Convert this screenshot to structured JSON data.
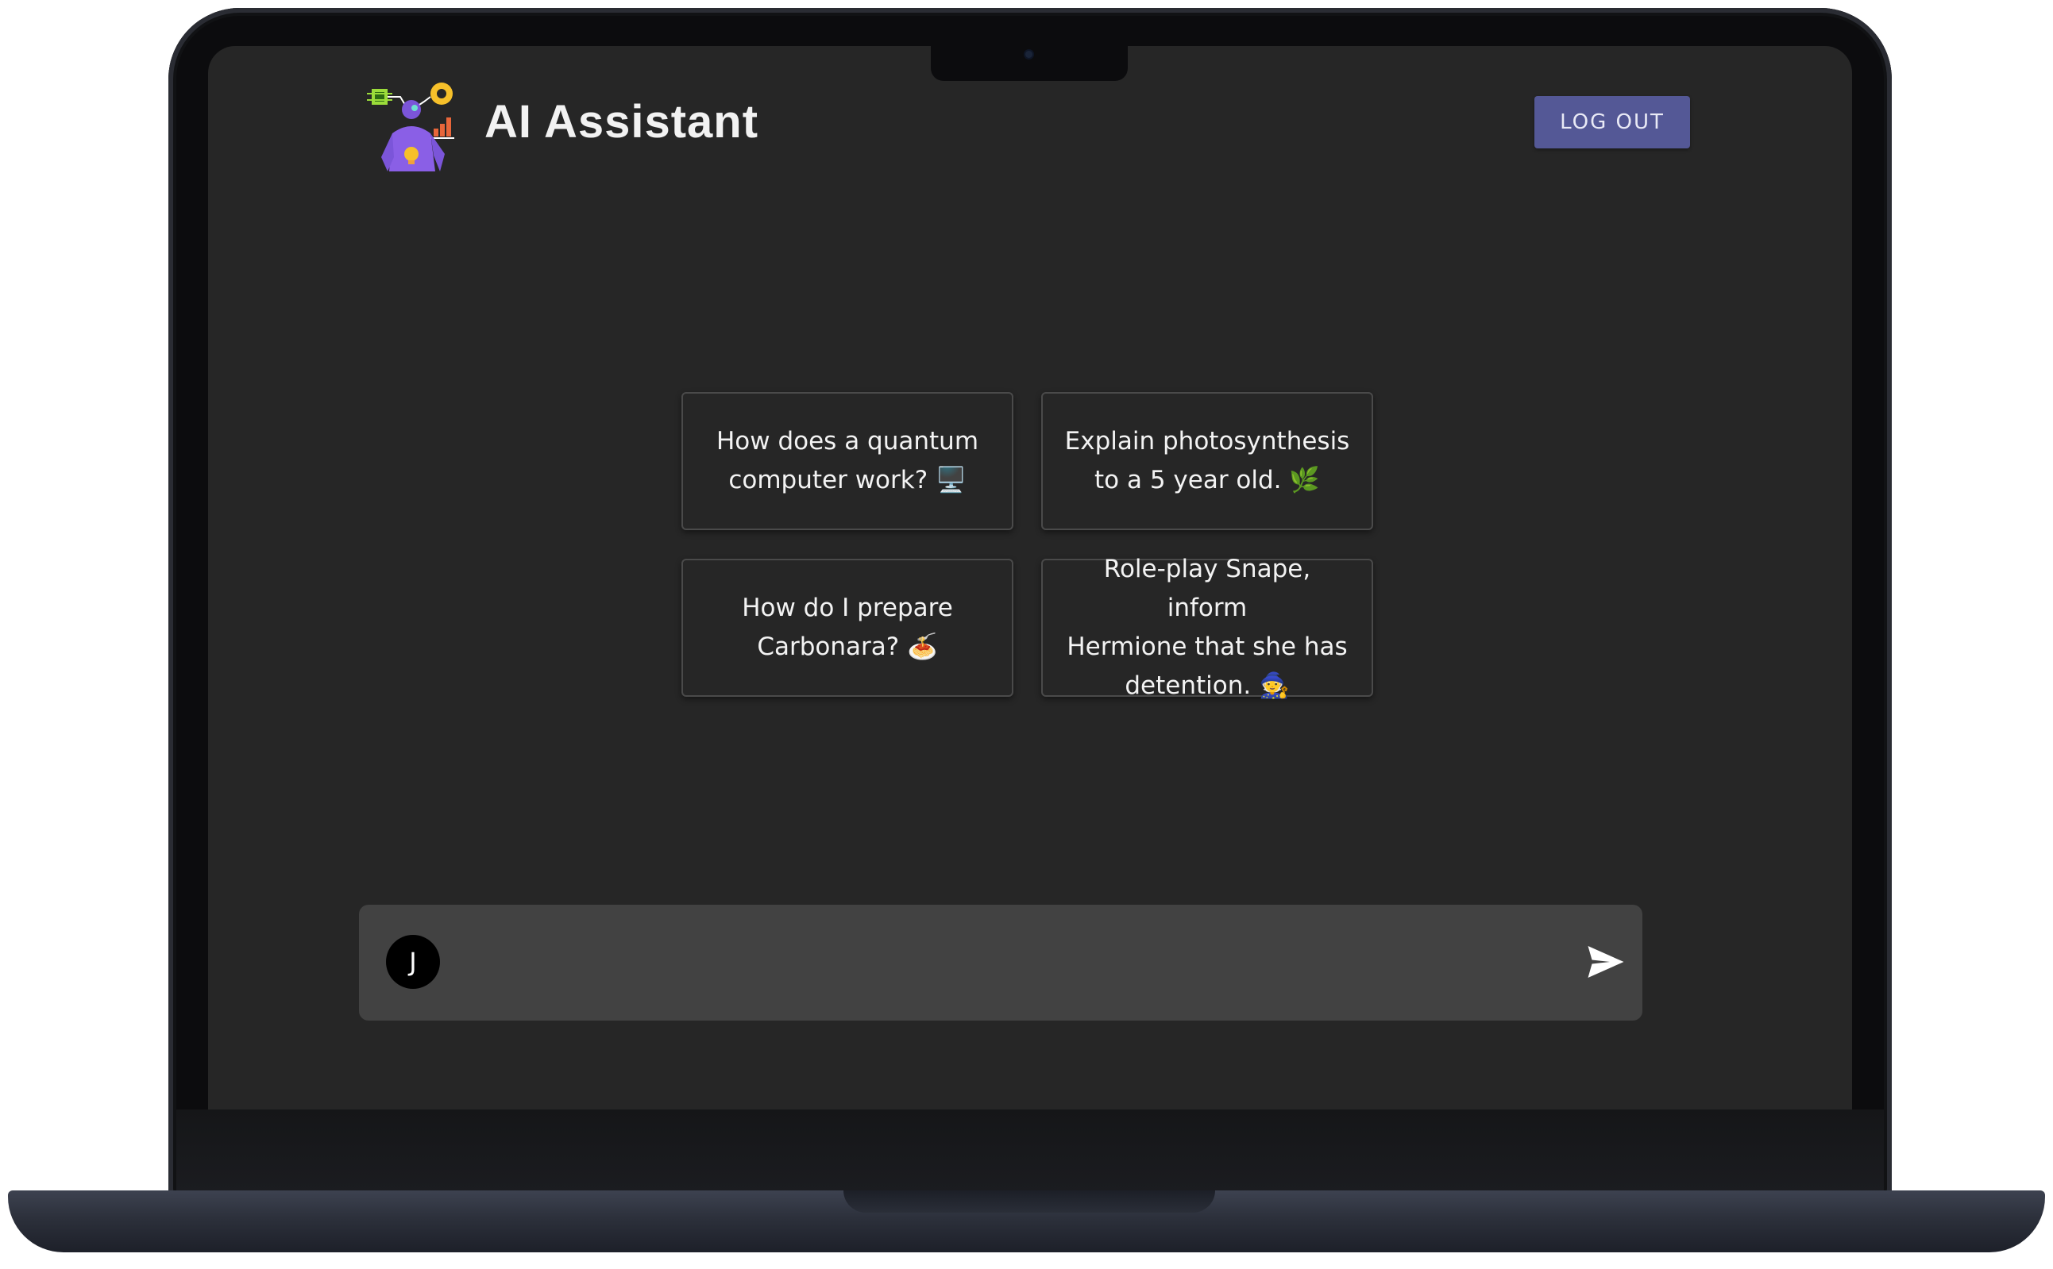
{
  "app": {
    "title": "AI Assistant",
    "logo_icon": "robot-assistant-icon",
    "accent_color": "#545896"
  },
  "header": {
    "logout_label": "LOG OUT"
  },
  "prompts": [
    {
      "line1": "How does a quantum",
      "line2": "computer work? 🖥️"
    },
    {
      "line1": "Explain photosynthesis",
      "line2": "to a 5 year old. 🌿"
    },
    {
      "line1": "How do I prepare",
      "line2": "Carbonara? 🍝"
    },
    {
      "line1": "Role-play Snape, inform",
      "line2": "Hermione that she has",
      "line3": "detention. 🧙"
    }
  ],
  "chat": {
    "avatar_initial": "J",
    "input_value": "",
    "input_placeholder": "",
    "send_icon": "send-icon"
  }
}
